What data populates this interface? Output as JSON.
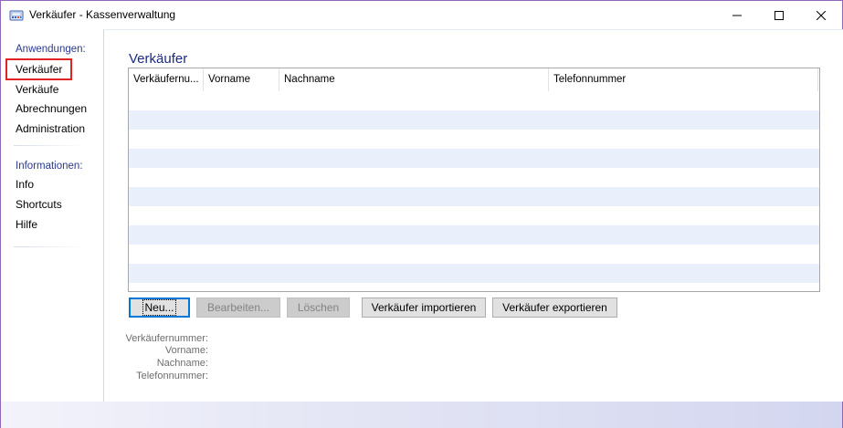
{
  "window": {
    "title": "Verkäufer - Kassenverwaltung",
    "icon": "app-register-icon",
    "controls": {
      "minimize": "minimize-icon",
      "maximize": "maximize-icon",
      "close": "close-icon"
    }
  },
  "nav": {
    "sections": [
      {
        "title": "Anwendungen:",
        "items": [
          "Verkäufer",
          "Verkäufe",
          "Abrechnungen",
          "Administration"
        ]
      },
      {
        "title": "Informationen:",
        "items": [
          "Info",
          "Shortcuts",
          "Hilfe"
        ]
      }
    ],
    "selected": "Verkäufer",
    "selected_highlight_color": "#e02424"
  },
  "main": {
    "title": "Verkäufer",
    "table": {
      "columns": [
        "Verkäufernu...",
        "Vorname",
        "Nachname",
        "Telefonnummer"
      ],
      "rows": []
    },
    "buttons": {
      "new": "Neu...",
      "edit": "Bearbeiten...",
      "delete": "Löschen",
      "import": "Verkäufer importieren",
      "export": "Verkäufer exportieren"
    },
    "details": {
      "number_label": "Verkäufernummer:",
      "firstname_label": "Vorname:",
      "lastname_label": "Nachname:",
      "phone_label": "Telefonnummer:"
    }
  },
  "colors": {
    "section_title": "#2b3990",
    "page_title": "#1b2a85",
    "row_alt": "#eaf0fb",
    "window_border": "#8e6ab8"
  }
}
